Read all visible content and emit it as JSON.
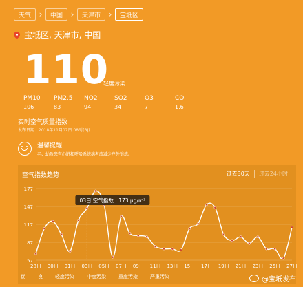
{
  "breadcrumb": [
    "天气",
    "中国",
    "天津市",
    "宝坻区"
  ],
  "location": "宝坻区, 天津市, 中国",
  "aqi": {
    "value": "110",
    "level": "轻度污染",
    "label": "实时空气质量指数",
    "publish_time": "发布日期：2018年11月07日 08时(BJ)"
  },
  "pollutants": [
    {
      "name": "PM10",
      "value": "106"
    },
    {
      "name": "PM2.5",
      "value": "83"
    },
    {
      "name": "NO2",
      "value": "94"
    },
    {
      "name": "SO2",
      "value": "34"
    },
    {
      "name": "O3",
      "value": "7"
    },
    {
      "name": "CO",
      "value": "1.6"
    }
  ],
  "tip": {
    "title": "温馨提醒",
    "text": "老、幼及患有心脏和呼吸系统病者应减少户外锻炼。"
  },
  "trend": {
    "title": "空气指数趋势",
    "tab_active": "过去30天",
    "tab_inactive": "过去24小时",
    "tooltip": "03日 空气指数 : 173 μg/m³"
  },
  "legend": [
    "优",
    "良",
    "轻度污染",
    "中度污染",
    "重度污染",
    "严重污染"
  ],
  "watermark": "@宝坻发布",
  "colors": {
    "background": "#f29a26",
    "panel": "#e2901f",
    "line": "#ffffff",
    "location_pin": "#e8432a",
    "marker": "#d0482b"
  },
  "chart_data": {
    "type": "line",
    "x": [
      "28日",
      "29日",
      "30日",
      "31日",
      "01日",
      "02日",
      "03日",
      "04日",
      "05日",
      "06日",
      "07日",
      "08日",
      "09日",
      "10日",
      "11日",
      "12日",
      "13日",
      "14日",
      "15日",
      "16日",
      "17日",
      "18日",
      "19日",
      "20日",
      "21日",
      "22日",
      "23日",
      "24日",
      "25日",
      "26日",
      "27日"
    ],
    "values": [
      68,
      110,
      122,
      100,
      72,
      124,
      144,
      173,
      150,
      62,
      130,
      102,
      98,
      96,
      80,
      76,
      76,
      74,
      110,
      118,
      150,
      145,
      100,
      90,
      96,
      85,
      96,
      76,
      76,
      60,
      112
    ],
    "y_ticks": [
      177,
      147,
      117,
      87,
      57
    ],
    "x_tick_labels": [
      "28日",
      "30日",
      "01日",
      "03日",
      "05日",
      "07日",
      "09日",
      "11日",
      "13日",
      "15日",
      "17日",
      "19日",
      "21日",
      "23日",
      "25日",
      "27日"
    ],
    "ylim": [
      57,
      177
    ],
    "grid": true
  }
}
